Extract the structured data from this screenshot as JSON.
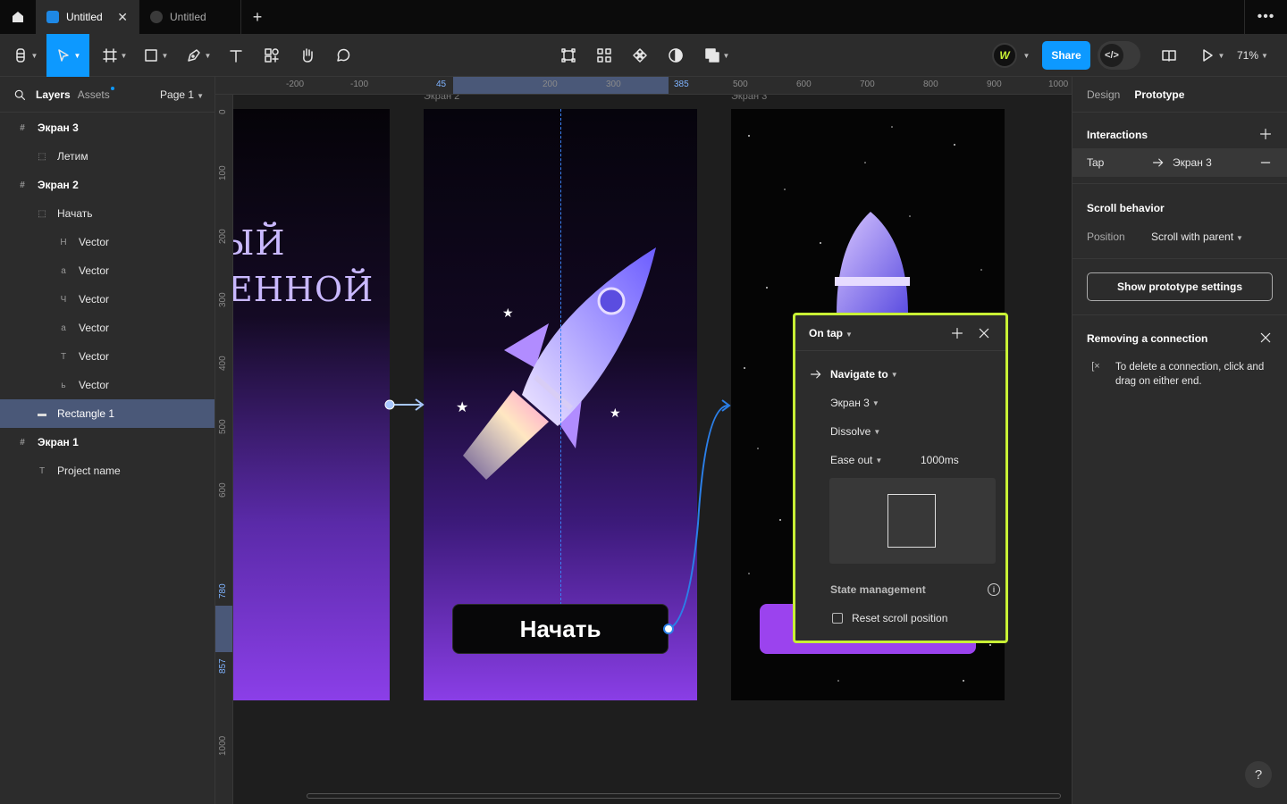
{
  "tabs": [
    {
      "label": "Untitled",
      "active": true
    },
    {
      "label": "Untitled",
      "active": false
    }
  ],
  "toolbar": {
    "share_label": "Share",
    "zoom": "71%",
    "avatar_initial": "W",
    "accent": "#0d99ff"
  },
  "left_panel": {
    "layers_tab": "Layers",
    "assets_tab": "Assets",
    "page_selector": "Page 1",
    "layers": [
      {
        "name": "Экран 3",
        "kind": "frame"
      },
      {
        "name": "Летим",
        "kind": "group"
      },
      {
        "name": "Экран 2",
        "kind": "frame"
      },
      {
        "name": "Начать",
        "kind": "group"
      },
      {
        "name": "Vector",
        "kind": "vector"
      },
      {
        "name": "Vector",
        "kind": "vector"
      },
      {
        "name": "Vector",
        "kind": "vector"
      },
      {
        "name": "Vector",
        "kind": "vector"
      },
      {
        "name": "Vector",
        "kind": "vector"
      },
      {
        "name": "Vector",
        "kind": "vector"
      },
      {
        "name": "Rectangle 1",
        "kind": "rect",
        "selected": true
      },
      {
        "name": "Экран 1",
        "kind": "frame"
      },
      {
        "name": "Project name",
        "kind": "text"
      }
    ]
  },
  "rulers": {
    "h": [
      "-200",
      "-100",
      "45",
      "200",
      "300",
      "385",
      "500",
      "600",
      "700",
      "800",
      "900",
      "1000"
    ],
    "v": [
      "0",
      "100",
      "200",
      "300",
      "400",
      "500",
      "600",
      "780",
      "857",
      "1000"
    ]
  },
  "canvas": {
    "frame2_label": "Экран 2",
    "frame3_label": "Экран 3",
    "frame1_text_1": "ЫЙ",
    "frame1_text_2": "ЕННОЙ",
    "start_button_text": "Начать"
  },
  "popup": {
    "trigger": "On tap",
    "action": "Navigate to",
    "destination": "Экран 3",
    "animation": "Dissolve",
    "easing": "Ease out",
    "duration": "1000ms",
    "state_management": "State management",
    "reset_scroll": "Reset scroll position",
    "reset_scroll_checked": false,
    "highlight_color": "#c8f135"
  },
  "right_panel": {
    "design_tab": "Design",
    "prototype_tab": "Prototype",
    "interactions_title": "Interactions",
    "interaction_trigger": "Tap",
    "interaction_target": "Экран 3",
    "scroll_title": "Scroll behavior",
    "position_label": "Position",
    "position_value": "Scroll with parent",
    "settings_button": "Show prototype settings",
    "removing_title": "Removing a connection",
    "removing_text": "To delete a connection, click and drag on either end."
  },
  "help_label": "?"
}
